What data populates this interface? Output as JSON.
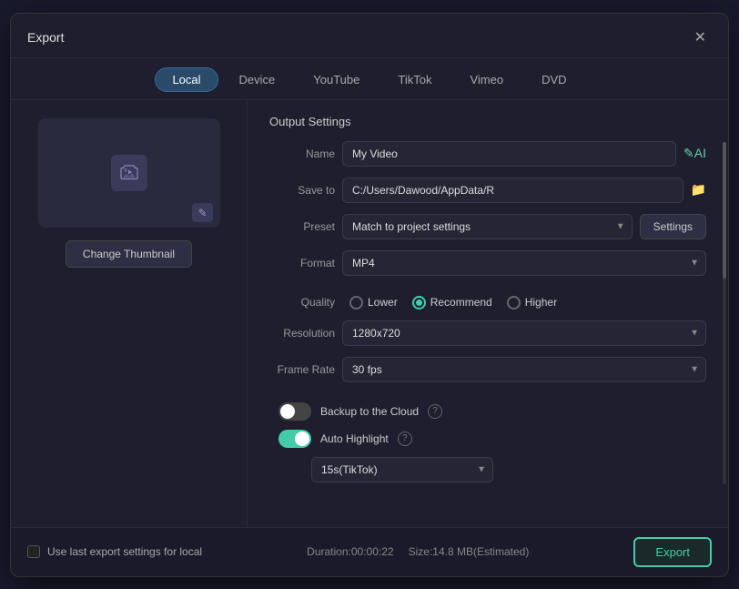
{
  "dialog": {
    "title": "Export",
    "close_label": "✕"
  },
  "tabs": [
    {
      "id": "local",
      "label": "Local",
      "active": true
    },
    {
      "id": "device",
      "label": "Device",
      "active": false
    },
    {
      "id": "youtube",
      "label": "YouTube",
      "active": false
    },
    {
      "id": "tiktok",
      "label": "TikTok",
      "active": false
    },
    {
      "id": "vimeo",
      "label": "Vimeo",
      "active": false
    },
    {
      "id": "dvd",
      "label": "DVD",
      "active": false
    }
  ],
  "thumbnail": {
    "change_label": "Change Thumbnail"
  },
  "output_settings": {
    "section_title": "Output Settings",
    "name_label": "Name",
    "name_value": "My Video",
    "save_to_label": "Save to",
    "save_to_value": "C:/Users/Dawood/AppData/R",
    "preset_label": "Preset",
    "preset_value": "Match to project settings",
    "settings_label": "Settings",
    "format_label": "Format",
    "format_value": "MP4",
    "quality_label": "Quality",
    "quality_options": [
      {
        "id": "lower",
        "label": "Lower",
        "selected": false
      },
      {
        "id": "recommend",
        "label": "Recommend",
        "selected": true
      },
      {
        "id": "higher",
        "label": "Higher",
        "selected": false
      }
    ],
    "resolution_label": "Resolution",
    "resolution_value": "1280x720",
    "frame_rate_label": "Frame Rate",
    "frame_rate_value": "30 fps",
    "backup_cloud_label": "Backup to the Cloud",
    "auto_highlight_label": "Auto Highlight",
    "highlight_duration": "15s(TikTok)"
  },
  "footer": {
    "use_last_label": "Use last export settings for local",
    "duration_label": "Duration:",
    "duration_value": "00:00:22",
    "size_label": "Size:",
    "size_value": "14.8 MB(Estimated)",
    "export_label": "Export"
  }
}
